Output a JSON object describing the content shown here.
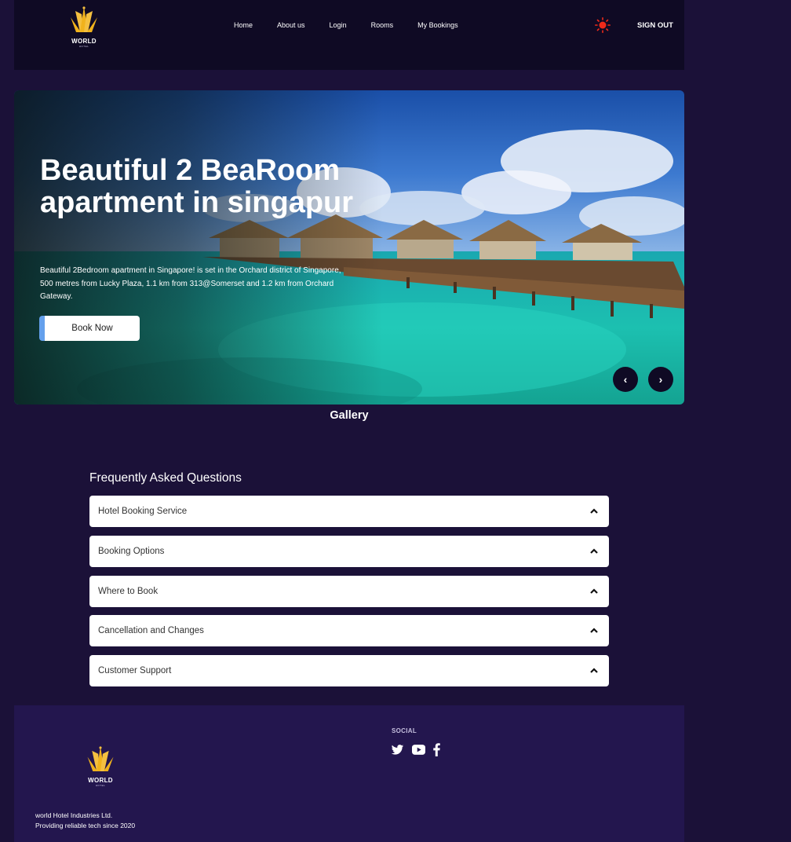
{
  "nav": {
    "logo_text": "WORLD",
    "logo_sub": "HOTEL",
    "links": [
      "Home",
      "About us",
      "Login",
      "Rooms",
      "My Bookings"
    ],
    "signout": "SIGN OUT"
  },
  "hero": {
    "title": "Beautiful 2 BeaRoom apartment in singapur",
    "description": "Beautiful 2Bedroom apartment in Singapore! is set in the Orchard district of Singapore, 500 metres from Lucky Plaza, 1.1 km from 313@Somerset and 1.2 km from Orchard Gateway.",
    "book_label": "Book Now",
    "prev": "‹",
    "next": "›"
  },
  "gallery": {
    "title": "Gallery"
  },
  "faq": {
    "title": "Frequently Asked Questions",
    "items": [
      "Hotel Booking Service",
      "Booking Options",
      "Where to Book",
      "Cancellation and Changes",
      "Customer Support"
    ]
  },
  "footer": {
    "logo_text": "WORLD",
    "logo_sub": "HOTEL",
    "company": "world Hotel Industries Ltd.",
    "tagline": "Providing reliable tech since 2020",
    "social_title": "SOCIAL",
    "social_icons": [
      "twitter-icon",
      "youtube-icon",
      "facebook-icon"
    ]
  },
  "colors": {
    "page_bg": "#1b1138",
    "nav_bg": "#0f0a24",
    "footer_bg": "#23164e",
    "accent_blue": "#64a0ec",
    "logo_gold": "#f0b21c",
    "sun_red": "#ee2a1a"
  }
}
